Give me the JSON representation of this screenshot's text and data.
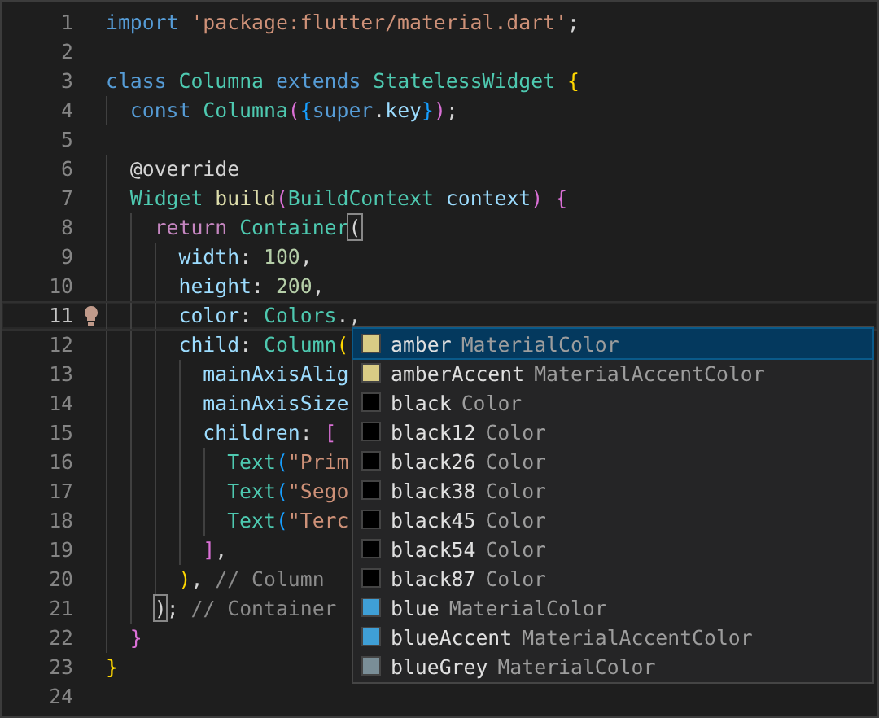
{
  "editor": {
    "lines": [
      {
        "number": "1",
        "current": false,
        "tokens": [
          {
            "kind": "keyword",
            "text": "import"
          },
          {
            "kind": "string",
            "text": " 'package:flutter/material.dart'"
          },
          {
            "kind": "plain",
            "text": ";"
          }
        ]
      },
      {
        "number": "2",
        "current": false
      },
      {
        "number": "3",
        "current": false,
        "tokens": [
          {
            "kind": "keyword",
            "text": "class"
          },
          {
            "kind": "type",
            "text": " Columna"
          },
          {
            "kind": "keyword",
            "text": " extends"
          },
          {
            "kind": "type",
            "text": " StatelessWidget"
          },
          {
            "kind": "bracket1",
            "text": " {"
          }
        ]
      },
      {
        "number": "4",
        "current": false,
        "tokens": [
          {
            "kind": "keyword",
            "text": "  const"
          },
          {
            "kind": "type",
            "text": " Columna"
          },
          {
            "kind": "bracket2",
            "text": "("
          },
          {
            "kind": "bracket3",
            "text": "{"
          },
          {
            "kind": "keyword",
            "text": "super"
          },
          {
            "kind": "plain",
            "text": "."
          },
          {
            "kind": "variable",
            "text": "key"
          },
          {
            "kind": "bracket3",
            "text": "}"
          },
          {
            "kind": "bracket2",
            "text": ")"
          },
          {
            "kind": "plain",
            "text": ";"
          }
        ]
      },
      {
        "number": "5",
        "current": false
      },
      {
        "number": "6",
        "current": false,
        "tokens": [
          {
            "kind": "plain",
            "text": "  @override"
          }
        ]
      },
      {
        "number": "7",
        "current": false,
        "tokens": [
          {
            "kind": "type",
            "text": "  Widget"
          },
          {
            "kind": "function",
            "text": " build"
          },
          {
            "kind": "bracket2",
            "text": "("
          },
          {
            "kind": "type",
            "text": "BuildContext"
          },
          {
            "kind": "variable",
            "text": " context"
          },
          {
            "kind": "bracket2",
            "text": ")"
          },
          {
            "kind": "bracket2",
            "text": " {"
          }
        ]
      },
      {
        "number": "8",
        "current": false,
        "tokens": [
          {
            "kind": "control",
            "text": "    return"
          },
          {
            "kind": "type",
            "text": " Container"
          },
          {
            "kind": "match",
            "text": "("
          }
        ]
      },
      {
        "number": "9",
        "current": false,
        "tokens": [
          {
            "kind": "variable",
            "text": "      width"
          },
          {
            "kind": "plain",
            "text": ": "
          },
          {
            "kind": "number",
            "text": "100"
          },
          {
            "kind": "plain",
            "text": ","
          }
        ]
      },
      {
        "number": "10",
        "current": false,
        "tokens": [
          {
            "kind": "variable",
            "text": "      height"
          },
          {
            "kind": "plain",
            "text": ": "
          },
          {
            "kind": "number",
            "text": "200"
          },
          {
            "kind": "plain",
            "text": ","
          }
        ]
      },
      {
        "number": "11",
        "current": true,
        "tokens": [
          {
            "kind": "variable",
            "text": "      color"
          },
          {
            "kind": "plain",
            "text": ": "
          },
          {
            "kind": "type",
            "text": "Colors"
          },
          {
            "kind": "plain",
            "text": ".,"
          }
        ]
      },
      {
        "number": "12",
        "current": false,
        "tokens": [
          {
            "kind": "variable",
            "text": "      child"
          },
          {
            "kind": "plain",
            "text": ": "
          },
          {
            "kind": "type",
            "text": "Column"
          },
          {
            "kind": "bracket1",
            "text": "("
          }
        ]
      },
      {
        "number": "13",
        "current": false,
        "tokens": [
          {
            "kind": "variable",
            "text": "        mainAxisAlig"
          }
        ]
      },
      {
        "number": "14",
        "current": false,
        "tokens": [
          {
            "kind": "variable",
            "text": "        mainAxisSize"
          }
        ]
      },
      {
        "number": "15",
        "current": false,
        "tokens": [
          {
            "kind": "variable",
            "text": "        children"
          },
          {
            "kind": "plain",
            "text": ":"
          },
          {
            "kind": "bracket2",
            "text": " ["
          }
        ]
      },
      {
        "number": "16",
        "current": false,
        "tokens": [
          {
            "kind": "type",
            "text": "          Text"
          },
          {
            "kind": "bracket3",
            "text": "("
          },
          {
            "kind": "string",
            "text": "\"Prim"
          }
        ]
      },
      {
        "number": "17",
        "current": false,
        "tokens": [
          {
            "kind": "type",
            "text": "          Text"
          },
          {
            "kind": "bracket3",
            "text": "("
          },
          {
            "kind": "string",
            "text": "\"Sego"
          }
        ]
      },
      {
        "number": "18",
        "current": false,
        "tokens": [
          {
            "kind": "type",
            "text": "          Text"
          },
          {
            "kind": "bracket3",
            "text": "("
          },
          {
            "kind": "string",
            "text": "\"Terc"
          }
        ]
      },
      {
        "number": "19",
        "current": false,
        "tokens": [
          {
            "kind": "bracket2",
            "text": "        ]"
          },
          {
            "kind": "plain",
            "text": ","
          }
        ]
      },
      {
        "number": "20",
        "current": false,
        "tokens": [
          {
            "kind": "bracket1",
            "text": "      )"
          },
          {
            "kind": "plain",
            "text": ","
          },
          {
            "kind": "label",
            "text": " // Column"
          }
        ]
      },
      {
        "number": "21",
        "current": false,
        "tokens": [
          {
            "kind": "match",
            "text": "    )"
          },
          {
            "kind": "plain",
            "text": ";"
          },
          {
            "kind": "label",
            "text": " // Container"
          }
        ]
      },
      {
        "number": "22",
        "current": false,
        "tokens": [
          {
            "kind": "bracket2",
            "text": "  }"
          }
        ]
      },
      {
        "number": "23",
        "current": false,
        "tokens": [
          {
            "kind": "bracket1",
            "text": "}"
          }
        ]
      },
      {
        "number": "24",
        "current": false
      }
    ]
  },
  "suggestions": [
    {
      "name": "amber",
      "detail": "MaterialColor",
      "color": "#d9cc85",
      "selected": true
    },
    {
      "name": "amberAccent",
      "detail": "MaterialAccentColor",
      "color": "#d9cc85",
      "selected": false
    },
    {
      "name": "black",
      "detail": "Color",
      "color": "#000000",
      "selected": false
    },
    {
      "name": "black12",
      "detail": "Color",
      "color": "#000000",
      "selected": false
    },
    {
      "name": "black26",
      "detail": "Color",
      "color": "#000000",
      "selected": false
    },
    {
      "name": "black38",
      "detail": "Color",
      "color": "#000000",
      "selected": false
    },
    {
      "name": "black45",
      "detail": "Color",
      "color": "#000000",
      "selected": false
    },
    {
      "name": "black54",
      "detail": "Color",
      "color": "#000000",
      "selected": false
    },
    {
      "name": "black87",
      "detail": "Color",
      "color": "#000000",
      "selected": false
    },
    {
      "name": "blue",
      "detail": "MaterialColor",
      "color": "#3f9fd6",
      "selected": false
    },
    {
      "name": "blueAccent",
      "detail": "MaterialAccentColor",
      "color": "#3f9fd6",
      "selected": false
    },
    {
      "name": "blueGrey",
      "detail": "MaterialColor",
      "color": "#7a8e97",
      "selected": false
    }
  ]
}
